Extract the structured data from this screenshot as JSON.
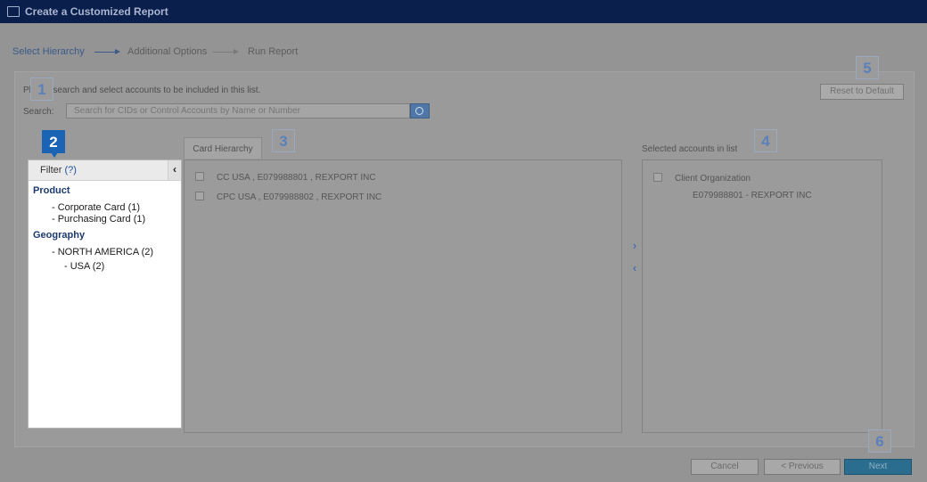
{
  "window": {
    "title": "Create a Customized Report"
  },
  "wizard": {
    "steps": [
      "Select Hierarchy",
      "Additional Options",
      "Run Report"
    ],
    "active_step": 0
  },
  "instructions": "Please search and select accounts to be included in this list.",
  "search": {
    "label": "Search:",
    "placeholder": "Search for CIDs or Control Accounts by Name or Number"
  },
  "reset_button": "Reset to Default",
  "badges": [
    "1",
    "2",
    "3",
    "4",
    "5",
    "6"
  ],
  "filter": {
    "title": "Filter",
    "help": "(?)",
    "collapse_glyph": "‹",
    "facets": [
      {
        "title": "Product",
        "items": [
          "- Corporate Card (1)",
          "- Purchasing Card (1)"
        ]
      },
      {
        "title": "Geography",
        "items": [
          "- NORTH AMERICA (2)",
          "- USA (2)"
        ]
      }
    ]
  },
  "hierarchy": {
    "tab": "Card Hierarchy",
    "rows": [
      "CC USA , E079988801 , REXPORT INC",
      "CPC USA , E079988802 , REXPORT INC"
    ]
  },
  "move_buttons": {
    "add": "›",
    "remove": "‹"
  },
  "selected": {
    "label": "Selected accounts in list",
    "org": "Client Organization",
    "accounts": [
      "E079988801 - REXPORT INC"
    ]
  },
  "footer": {
    "cancel": "Cancel",
    "previous": "< Previous",
    "next": "Next"
  },
  "colors": {
    "titlebar": "#0b1f4d",
    "badge_active": "#1b63b5",
    "link": "#1e4f9c",
    "next_button": "#2b6d8f"
  }
}
